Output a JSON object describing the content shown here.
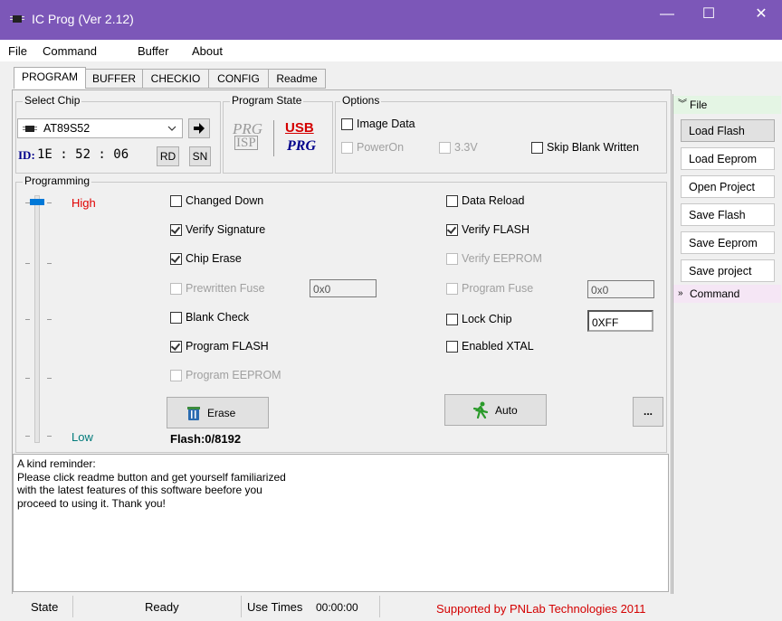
{
  "window": {
    "title": "IC Prog (Ver 2.12)",
    "minimize": "—",
    "maximize": "☐",
    "close": "✕"
  },
  "menu": [
    "File",
    "Command",
    "Buffer",
    "About"
  ],
  "tabs": [
    "PROGRAM",
    "BUFFER",
    "CHECKIO",
    "CONFIG",
    "Readme"
  ],
  "select_chip": {
    "label": "Select Chip",
    "chip": "AT89S52",
    "id_label": "ID:",
    "id_value": "1E : 52 : 06",
    "rd": "RD",
    "sn": "SN"
  },
  "program_state": {
    "label": "Program State",
    "prg1": "PRG",
    "isp": "ISP",
    "usb": "USB",
    "prg2": "PRG"
  },
  "options": {
    "label": "Options",
    "image_data": "Image Data",
    "poweron": "PowerOn",
    "v33": "3.3V",
    "skip_blank": "Skip Blank Written"
  },
  "programming": {
    "label": "Programming",
    "high": "High",
    "low": "Low",
    "left": [
      {
        "label": "Changed Down",
        "checked": false,
        "enabled": true
      },
      {
        "label": "Verify Signature",
        "checked": true,
        "enabled": true
      },
      {
        "label": "Chip Erase",
        "checked": true,
        "enabled": true
      },
      {
        "label": "Prewritten Fuse",
        "checked": false,
        "enabled": false
      },
      {
        "label": "Blank Check",
        "checked": false,
        "enabled": true
      },
      {
        "label": "Program FLASH",
        "checked": true,
        "enabled": true
      },
      {
        "label": "Program EEPROM",
        "checked": false,
        "enabled": false
      }
    ],
    "right": [
      {
        "label": "Data Reload",
        "checked": false,
        "enabled": true
      },
      {
        "label": "Verify FLASH",
        "checked": true,
        "enabled": true
      },
      {
        "label": "Verify EEPROM",
        "checked": false,
        "enabled": false
      },
      {
        "label": "Program Fuse",
        "checked": false,
        "enabled": false
      },
      {
        "label": "Lock Chip",
        "checked": false,
        "enabled": true
      },
      {
        "label": "Enabled XTAL",
        "checked": false,
        "enabled": true
      }
    ],
    "prewritten_fuse_value": "0x0",
    "program_fuse_value": "0x0",
    "lock_chip_value": "0XFF",
    "erase": "Erase",
    "auto": "Auto",
    "more": "...",
    "flash_status": "Flash:0/8192"
  },
  "reminder": {
    "line1": "A kind reminder:",
    "line2": "Please click readme button and get yourself familiarized",
    "line3": "with the latest features of this software beefore you",
    "line4": "proceed to using it. Thank you!"
  },
  "sidebar": {
    "file_header": "File",
    "buttons": [
      "Load Flash",
      "Load Eeprom",
      "Open Project",
      "Save Flash",
      "Save Eeprom",
      "Save project"
    ],
    "command_header": "Command"
  },
  "status": {
    "state": "State",
    "ready": "Ready",
    "use_times": "Use Times",
    "time": "00:00:00",
    "supported": "Supported by PNLab Technologies 2011"
  },
  "colors": {
    "titlebar": "#7c57b8",
    "high": "#e00000",
    "low": "#007a7a",
    "id": "#00008b",
    "usb": "#d40000",
    "supported": "#d40000"
  }
}
